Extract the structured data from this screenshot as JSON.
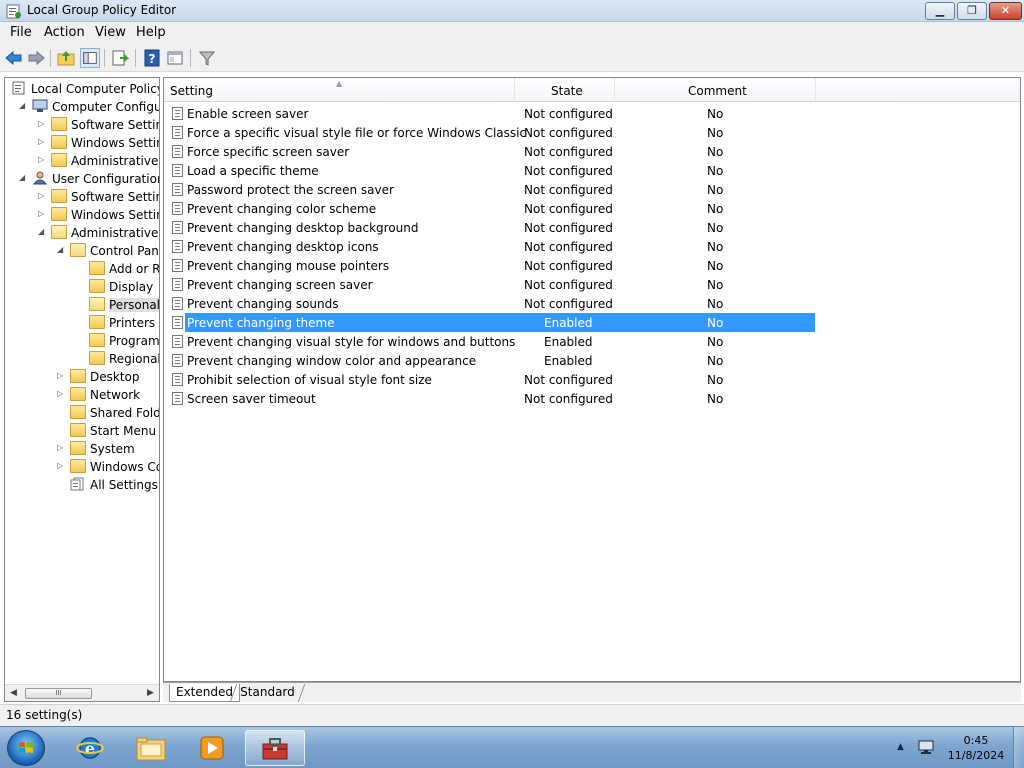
{
  "window": {
    "title": "Local Group Policy Editor"
  },
  "menu": [
    "File",
    "Action",
    "View",
    "Help"
  ],
  "toolbar_icons": [
    "back-arrow-icon",
    "forward-arrow-icon",
    "up-folder-icon",
    "show-hide-tree-icon",
    "export-list-icon",
    "help-icon",
    "properties-icon",
    "filter-icon"
  ],
  "tree": {
    "items": [
      {
        "label": "Local Computer Policy",
        "indent": 0,
        "expander": "none",
        "icon": "policy"
      },
      {
        "label": "Computer Configura",
        "indent": 1,
        "expander": "open",
        "icon": "computer"
      },
      {
        "label": "Software Settings",
        "indent": 2,
        "expander": "closed",
        "icon": "folder"
      },
      {
        "label": "Windows Setting",
        "indent": 2,
        "expander": "closed",
        "icon": "folder"
      },
      {
        "label": "Administrative Te",
        "indent": 2,
        "expander": "closed",
        "icon": "folder"
      },
      {
        "label": "User Configuration",
        "indent": 1,
        "expander": "open",
        "icon": "user"
      },
      {
        "label": "Software Settings",
        "indent": 2,
        "expander": "closed",
        "icon": "folder"
      },
      {
        "label": "Windows Setting",
        "indent": 2,
        "expander": "closed",
        "icon": "folder"
      },
      {
        "label": "Administrative Te",
        "indent": 2,
        "expander": "open",
        "icon": "folder-open"
      },
      {
        "label": "Control Panel",
        "indent": 3,
        "expander": "open",
        "icon": "folder-open"
      },
      {
        "label": "Add or Re",
        "indent": 4,
        "expander": "none",
        "icon": "folder"
      },
      {
        "label": "Display",
        "indent": 4,
        "expander": "none",
        "icon": "folder"
      },
      {
        "label": "Personaliz",
        "indent": 4,
        "expander": "none",
        "icon": "folder-open",
        "selected": true
      },
      {
        "label": "Printers",
        "indent": 4,
        "expander": "none",
        "icon": "folder"
      },
      {
        "label": "Programs",
        "indent": 4,
        "expander": "none",
        "icon": "folder"
      },
      {
        "label": "Regional a",
        "indent": 4,
        "expander": "none",
        "icon": "folder"
      },
      {
        "label": "Desktop",
        "indent": 3,
        "expander": "closed",
        "icon": "folder"
      },
      {
        "label": "Network",
        "indent": 3,
        "expander": "closed",
        "icon": "folder"
      },
      {
        "label": "Shared Folder",
        "indent": 3,
        "expander": "none",
        "icon": "folder"
      },
      {
        "label": "Start Menu ar",
        "indent": 3,
        "expander": "none",
        "icon": "folder"
      },
      {
        "label": "System",
        "indent": 3,
        "expander": "closed",
        "icon": "folder"
      },
      {
        "label": "Windows Cor",
        "indent": 3,
        "expander": "closed",
        "icon": "folder"
      },
      {
        "label": "All Settings",
        "indent": 3,
        "expander": "none",
        "icon": "all-settings"
      }
    ],
    "scroll_thumb": "III"
  },
  "list": {
    "columns": [
      "Setting",
      "State",
      "Comment"
    ],
    "rows": [
      {
        "setting": "Enable screen saver",
        "state": "Not configured",
        "comment": "No"
      },
      {
        "setting": "Force a specific visual style file or force Windows Classic",
        "state": "Not configured",
        "comment": "No"
      },
      {
        "setting": "Force specific screen saver",
        "state": "Not configured",
        "comment": "No"
      },
      {
        "setting": "Load a specific theme",
        "state": "Not configured",
        "comment": "No"
      },
      {
        "setting": "Password protect the screen saver",
        "state": "Not configured",
        "comment": "No"
      },
      {
        "setting": "Prevent changing color scheme",
        "state": "Not configured",
        "comment": "No"
      },
      {
        "setting": "Prevent changing desktop background",
        "state": "Not configured",
        "comment": "No"
      },
      {
        "setting": "Prevent changing desktop icons",
        "state": "Not configured",
        "comment": "No"
      },
      {
        "setting": "Prevent changing mouse pointers",
        "state": "Not configured",
        "comment": "No"
      },
      {
        "setting": "Prevent changing screen saver",
        "state": "Not configured",
        "comment": "No"
      },
      {
        "setting": "Prevent changing sounds",
        "state": "Not configured",
        "comment": "No"
      },
      {
        "setting": "Prevent changing theme",
        "state": "Enabled",
        "comment": "No",
        "selected": true
      },
      {
        "setting": "Prevent changing visual style for windows and buttons",
        "state": "Enabled",
        "comment": "No"
      },
      {
        "setting": "Prevent changing window color and appearance",
        "state": "Enabled",
        "comment": "No"
      },
      {
        "setting": "Prohibit selection of visual style font size",
        "state": "Not configured",
        "comment": "No"
      },
      {
        "setting": "Screen saver timeout",
        "state": "Not configured",
        "comment": "No"
      }
    ]
  },
  "tabs": {
    "extended": "Extended",
    "standard": "Standard"
  },
  "status": {
    "text": "16 setting(s)"
  },
  "taskbar": {
    "apps": [
      "internet-explorer-icon",
      "windows-explorer-icon",
      "media-player-icon",
      "group-policy-editor-icon"
    ],
    "clock": {
      "time": "0:45",
      "date": "11/8/2024"
    }
  },
  "colors": {
    "selection": "#3399ff",
    "titlebar": "#c7d8ec",
    "taskbar": "#7ea5cf"
  }
}
